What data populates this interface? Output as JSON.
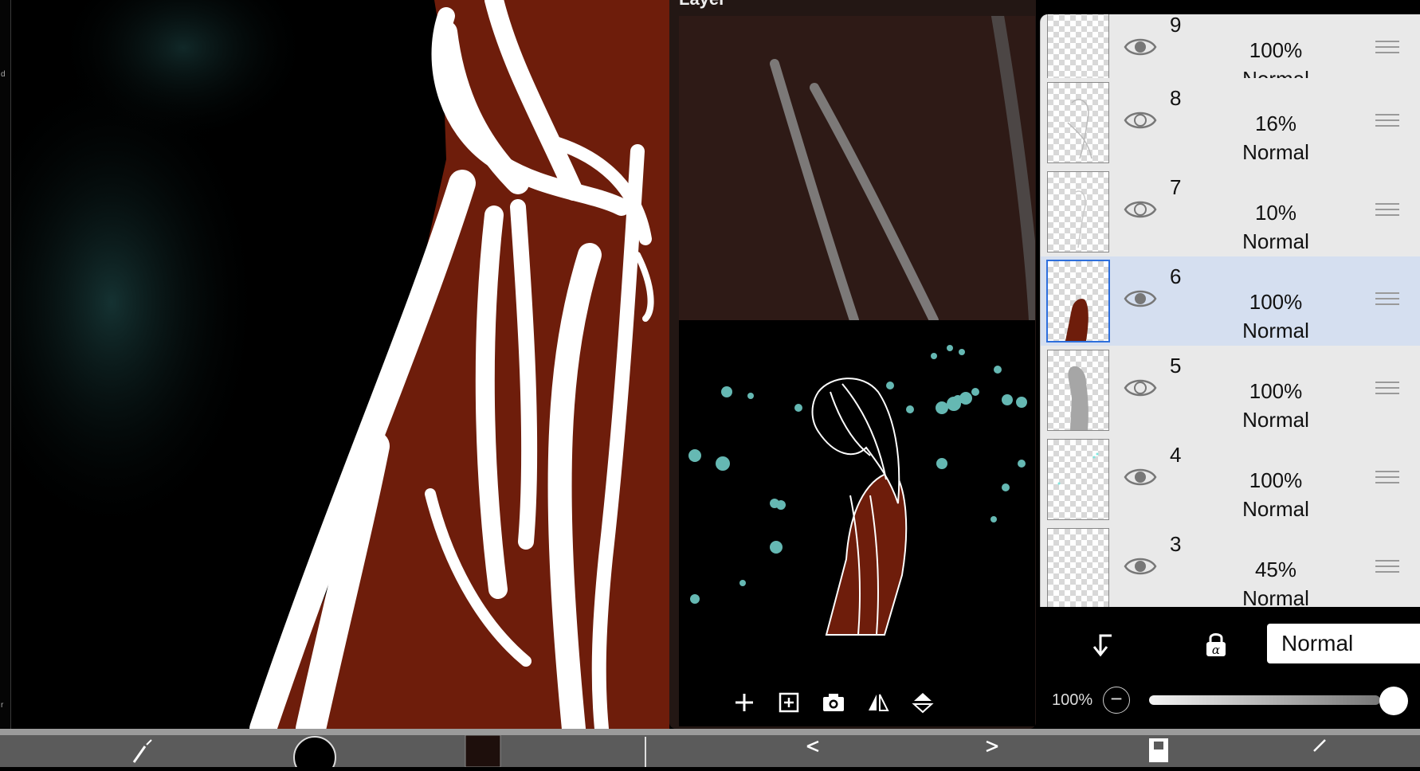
{
  "layer_window": {
    "title": "Layer",
    "toolbar": [
      {
        "name": "add-layer-button",
        "icon": "plus-icon"
      },
      {
        "name": "add-layer-from-selection-button",
        "icon": "plus-square-icon"
      },
      {
        "name": "import-photo-button",
        "icon": "camera-icon"
      },
      {
        "name": "flip-horizontal-button",
        "icon": "flip-horizontal-icon"
      },
      {
        "name": "flip-vertical-button",
        "icon": "flip-vertical-icon"
      }
    ]
  },
  "layers": [
    {
      "number": "9",
      "opacity": "100%",
      "blend": "Normal",
      "visible": true,
      "selected": false
    },
    {
      "number": "8",
      "opacity": "16%",
      "blend": "Normal",
      "visible": true,
      "selected": false
    },
    {
      "number": "7",
      "opacity": "10%",
      "blend": "Normal",
      "visible": true,
      "selected": false
    },
    {
      "number": "6",
      "opacity": "100%",
      "blend": "Normal",
      "visible": true,
      "selected": true
    },
    {
      "number": "5",
      "opacity": "100%",
      "blend": "Normal",
      "visible": true,
      "selected": false
    },
    {
      "number": "4",
      "opacity": "100%",
      "blend": "Normal",
      "visible": true,
      "selected": false
    },
    {
      "number": "3",
      "opacity": "45%",
      "blend": "Normal",
      "visible": true,
      "selected": false
    }
  ],
  "layer_controls": {
    "clipping_icon": "clip-arrow-icon",
    "alpha_lock_icon": "alpha-lock-icon",
    "blend_mode": "Normal",
    "opacity_label": "100%",
    "opacity_level": 1.0
  },
  "colors": {
    "canvas_bg": "#000000",
    "fill_red": "#6e1d0b",
    "selection_blue": "#2e6fdc",
    "selected_row": "#d5dff0"
  }
}
